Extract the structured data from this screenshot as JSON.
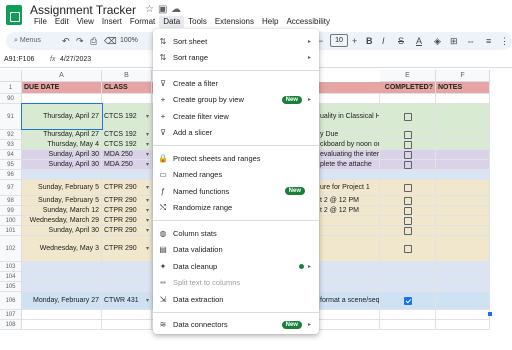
{
  "title": "Assignment Tracker",
  "title_icons": [
    "star-icon",
    "move-icon",
    "cloud-icon"
  ],
  "menubar": [
    "File",
    "Edit",
    "View",
    "Insert",
    "Format",
    "Data",
    "Tools",
    "Extensions",
    "Help",
    "Accessibility"
  ],
  "toolbar": {
    "search_placeholder": "Menus",
    "zoom": "100%",
    "font_size": "10"
  },
  "formula_bar": {
    "cell_ref": "A91:F106",
    "fx": "fx",
    "value": "4/27/2023"
  },
  "columns": [
    "A",
    "B",
    "E",
    "F"
  ],
  "header_row": {
    "num": "1",
    "due_date": "DUE DATE",
    "class": "CLASS",
    "completed": "COMPLETED?",
    "notes": "NOTES"
  },
  "rows": [
    {
      "num": "90",
      "date": "",
      "cls": "",
      "desc": "",
      "cb": false,
      "color": "#ffffff"
    },
    {
      "num": "91",
      "date": "Thursday, April 27",
      "cls": "CTCS 192",
      "desc": "uality in Classical Ho",
      "cb": true,
      "color": "#d9ead3"
    },
    {
      "num": "92",
      "date": "Thursday, April 27",
      "cls": "CTCS 192",
      "desc": "y Due",
      "cb": true,
      "color": "#d9ead3"
    },
    {
      "num": "93",
      "date": "Thursday, May 4",
      "cls": "CTCS 192",
      "desc": "ckboard by noon on",
      "cb": true,
      "color": "#d9ead3"
    },
    {
      "num": "94",
      "date": "Sunday, April 30",
      "cls": "MDA 250",
      "desc": "evaluating the intern",
      "cb": true,
      "color": "#d9d2e9"
    },
    {
      "num": "95",
      "date": "Sunday, April 30",
      "cls": "MDA 250",
      "desc": "plete the attache",
      "cb": true,
      "color": "#d9d2e9"
    },
    {
      "num": "96",
      "date": "",
      "cls": "",
      "desc": "",
      "cb": false,
      "color": "#dbe4f5"
    },
    {
      "num": "97",
      "date": "Sunday, February 5",
      "cls": "CTPR 290",
      "desc": "ure for Project 1",
      "cb": true,
      "color": "#f1e7cc"
    },
    {
      "num": "98",
      "date": "Sunday, February 5",
      "cls": "CTPR 290",
      "desc": "t 2 @ 12 PM",
      "cb": true,
      "color": "#f1e7cc"
    },
    {
      "num": "99",
      "date": "Sunday, March 12",
      "cls": "CTPR 290",
      "desc": "t 2 @ 12 PM",
      "cb": true,
      "color": "#f1e7cc"
    },
    {
      "num": "100",
      "date": "Wednesday, March 29",
      "cls": "CTPR 290",
      "desc": "",
      "cb": true,
      "color": "#f1e7cc"
    },
    {
      "num": "101",
      "date": "Sunday, April 30",
      "cls": "CTPR 290",
      "desc": "",
      "cb": true,
      "color": "#f1e7cc"
    },
    {
      "num": "102",
      "date": "Wednesday, May 3",
      "cls": "CTPR 290",
      "desc": "",
      "cb": true,
      "color": "#f1e7cc"
    },
    {
      "num": "103",
      "date": "",
      "cls": "",
      "desc": "",
      "cb": false,
      "color": "#dbe4f5"
    },
    {
      "num": "104",
      "date": "",
      "cls": "",
      "desc": "",
      "cb": false,
      "color": "#dbe4f5"
    },
    {
      "num": "105",
      "date": "",
      "cls": "",
      "desc": "",
      "cb": false,
      "color": "#dbe4f5"
    },
    {
      "num": "106",
      "date": "Monday, February 27",
      "cls": "CTWR 431",
      "desc": "format a scene/seq",
      "cb": "checked",
      "color": "#cfe2f3"
    },
    {
      "num": "107",
      "date": "",
      "cls": "",
      "desc": "",
      "cb": false,
      "color": "#ffffff"
    },
    {
      "num": "108",
      "date": "",
      "cls": "",
      "desc": "",
      "cb": false,
      "color": "#ffffff"
    }
  ],
  "data_menu": [
    {
      "icon": "sort-icon",
      "glyph": "⇅",
      "label": "Sort sheet",
      "arrow": true
    },
    {
      "icon": "sort-range-icon",
      "glyph": "⇅",
      "label": "Sort range",
      "arrow": true
    },
    {
      "sep": true
    },
    {
      "icon": "filter-icon",
      "glyph": "⊽",
      "label": "Create a filter"
    },
    {
      "icon": "group-icon",
      "glyph": "+",
      "label": "Create group by view",
      "badge": "New",
      "arrow": true
    },
    {
      "icon": "filter-view-icon",
      "glyph": "+",
      "label": "Create filter view"
    },
    {
      "icon": "slicer-icon",
      "glyph": "⊽",
      "label": "Add a slicer"
    },
    {
      "sep": true
    },
    {
      "icon": "lock-icon",
      "glyph": "🔒",
      "label": "Protect sheets and ranges"
    },
    {
      "icon": "named-ranges-icon",
      "glyph": "▭",
      "label": "Named ranges"
    },
    {
      "icon": "function-icon",
      "glyph": "ƒ",
      "label": "Named functions",
      "badge": "New"
    },
    {
      "icon": "shuffle-icon",
      "glyph": "⤭",
      "label": "Randomize range"
    },
    {
      "sep": true
    },
    {
      "icon": "lightbulb-icon",
      "glyph": "◍",
      "label": "Column stats"
    },
    {
      "icon": "validation-icon",
      "glyph": "▤",
      "label": "Data validation"
    },
    {
      "icon": "cleanup-icon",
      "glyph": "✦",
      "label": "Data cleanup",
      "dot": true,
      "arrow": true
    },
    {
      "icon": "split-icon",
      "glyph": "⇹",
      "label": "Split text to columns",
      "disabled": true
    },
    {
      "icon": "extract-icon",
      "glyph": "⇲",
      "label": "Data extraction"
    },
    {
      "sep": true
    },
    {
      "icon": "database-icon",
      "glyph": "≋",
      "label": "Data connectors",
      "badge": "New",
      "arrow": true
    }
  ]
}
